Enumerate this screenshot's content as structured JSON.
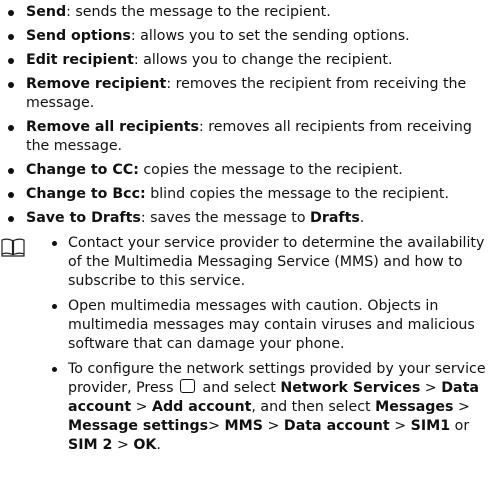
{
  "options": [
    {
      "term": "Send",
      "desc": ": sends the message to the recipient."
    },
    {
      "term": "Send options",
      "desc": ": allows you to set the sending options."
    },
    {
      "term": "Edit recipient",
      "desc": ": allows you to change the recipient."
    },
    {
      "term": "Remove recipient",
      "desc": ": removes the recipient from receiving the message."
    },
    {
      "term": "Remove all recipients",
      "desc": ": removes all recipients from receiving the message."
    },
    {
      "term": "Change to CC:",
      "desc": " copies the message to the recipient."
    },
    {
      "term": "Change to Bcc:",
      "desc": " blind copies the message to the recipient."
    },
    {
      "term": "Save to Drafts",
      "desc": ": saves the message to ",
      "term2": "Drafts",
      "desc2": "."
    }
  ],
  "notes": {
    "icon": "book-icon",
    "items": [
      "Contact your service provider to determine the availability of the Multimedia Messaging Service (MMS) and how to subscribe to this service.",
      "Open multimedia messages with caution. Objects in multimedia messages may contain viruses and malicious software that can damage your phone."
    ],
    "config": {
      "t1": "To configure the network settings provided by your service provider, Press ",
      "key_icon": "square-key-icon",
      "t2": " and select ",
      "b1": "Network Services",
      "t3": " > ",
      "b2": "Data account",
      "t4": " > ",
      "b3": "Add account",
      "t5": ", and then select ",
      "b4": "Messages",
      "t6": " > ",
      "b5": "Message settings",
      "t7": "> ",
      "b6": "MMS",
      "t8": " > ",
      "b7": "Data account",
      "t9": " > ",
      "b8": "SIM1",
      "t10": " or ",
      "b9": "SIM 2",
      "t11": " > ",
      "b10": "OK",
      "t12": "."
    }
  }
}
